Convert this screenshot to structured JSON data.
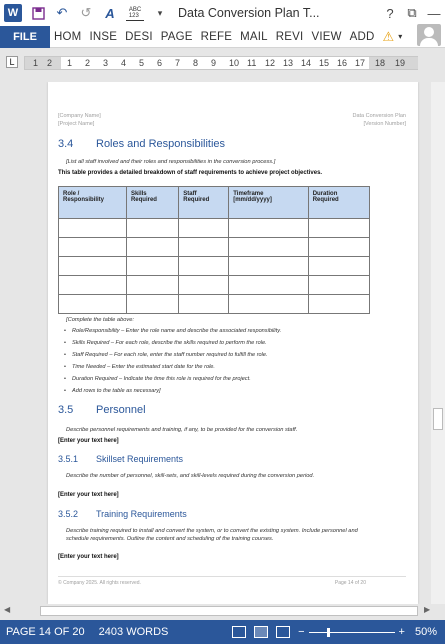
{
  "app": {
    "logo_letter": "W",
    "title": "Data Conversion Plan T...",
    "help": "?",
    "restore_icon": "⧉",
    "minimize_icon": "—",
    "save_icon": "💾",
    "undo_icon": "↶",
    "redo_icon": "↺",
    "format_icon": "A",
    "spell_label": "ABC\n123",
    "more_icon": "▾"
  },
  "ribbon": {
    "file": "FILE",
    "tabs": [
      "HOM",
      "INSE",
      "DESI",
      "PAGE",
      "REFE",
      "MAIL",
      "REVI",
      "VIEW",
      "ADD"
    ],
    "warning_icon": "⚠",
    "dropdown_icon": "▾"
  },
  "ruler": {
    "tab_selector": "L",
    "numbers": [
      "1",
      "2",
      "1",
      "2",
      "3",
      "4",
      "5",
      "6",
      "7",
      "8",
      "9",
      "10",
      "11",
      "12",
      "13",
      "14",
      "15",
      "16",
      "17",
      "18",
      "19"
    ]
  },
  "doc": {
    "header_left": [
      "[Company Name]",
      "[Project Name]"
    ],
    "header_right": [
      "Data Conversion Plan",
      "[Version Number]"
    ],
    "s34_num": "3.4",
    "s34_title": "Roles and Responsibilities",
    "s34_instr": "[List all staff involved and their roles and responsibilities in the conversion process.]",
    "s34_intro": "This table provides a detailed breakdown of staff requirements to achieve project objectives.",
    "table_headers": [
      "Role / Responsibility",
      "Skills Required",
      "Staff Required",
      "Timeframe [mm/dd/yyyy]",
      "Duration Required"
    ],
    "complete_note": "[Complete the table above:",
    "bullets": [
      "Role/Responsibility – Enter the role name and describe the associated responsibility.",
      "Skills Required – For each role, describe the skills required to perform the role.",
      "Staff Required – For each role, enter the staff number required to fulfill the role.",
      "Time Needed – Enter the estimated start date for the role.",
      "Duration Required – Indicate the time this role is required for the project.",
      "Add rows to the table as necessary]"
    ],
    "s35_num": "3.5",
    "s35_title": "Personnel",
    "s35_desc": "Describe personnel requirements and training, if any, to be provided for the conversion staff.",
    "enter_text": "[Enter your text here]",
    "s351_num": "3.5.1",
    "s351_title": "Skillset Requirements",
    "s351_desc": "Describe the number of personnel, skill-sets, and skill-levels required during the conversion period.",
    "s352_num": "3.5.2",
    "s352_title": "Training Requirements",
    "s352_desc": "Describe training required to install and convert the system, or to convert the existing system. Include personnel and schedule requirements. Outline the content and scheduling of the training courses.",
    "footer_left": "© Company 2025. All rights reserved.",
    "footer_right": "Page 14 of 20"
  },
  "status": {
    "page": "PAGE 14 OF 20",
    "words": "2403 WORDS",
    "zoom_minus": "−",
    "zoom_plus": "+",
    "zoom": "50%",
    "zoom_level_percent": 50
  }
}
